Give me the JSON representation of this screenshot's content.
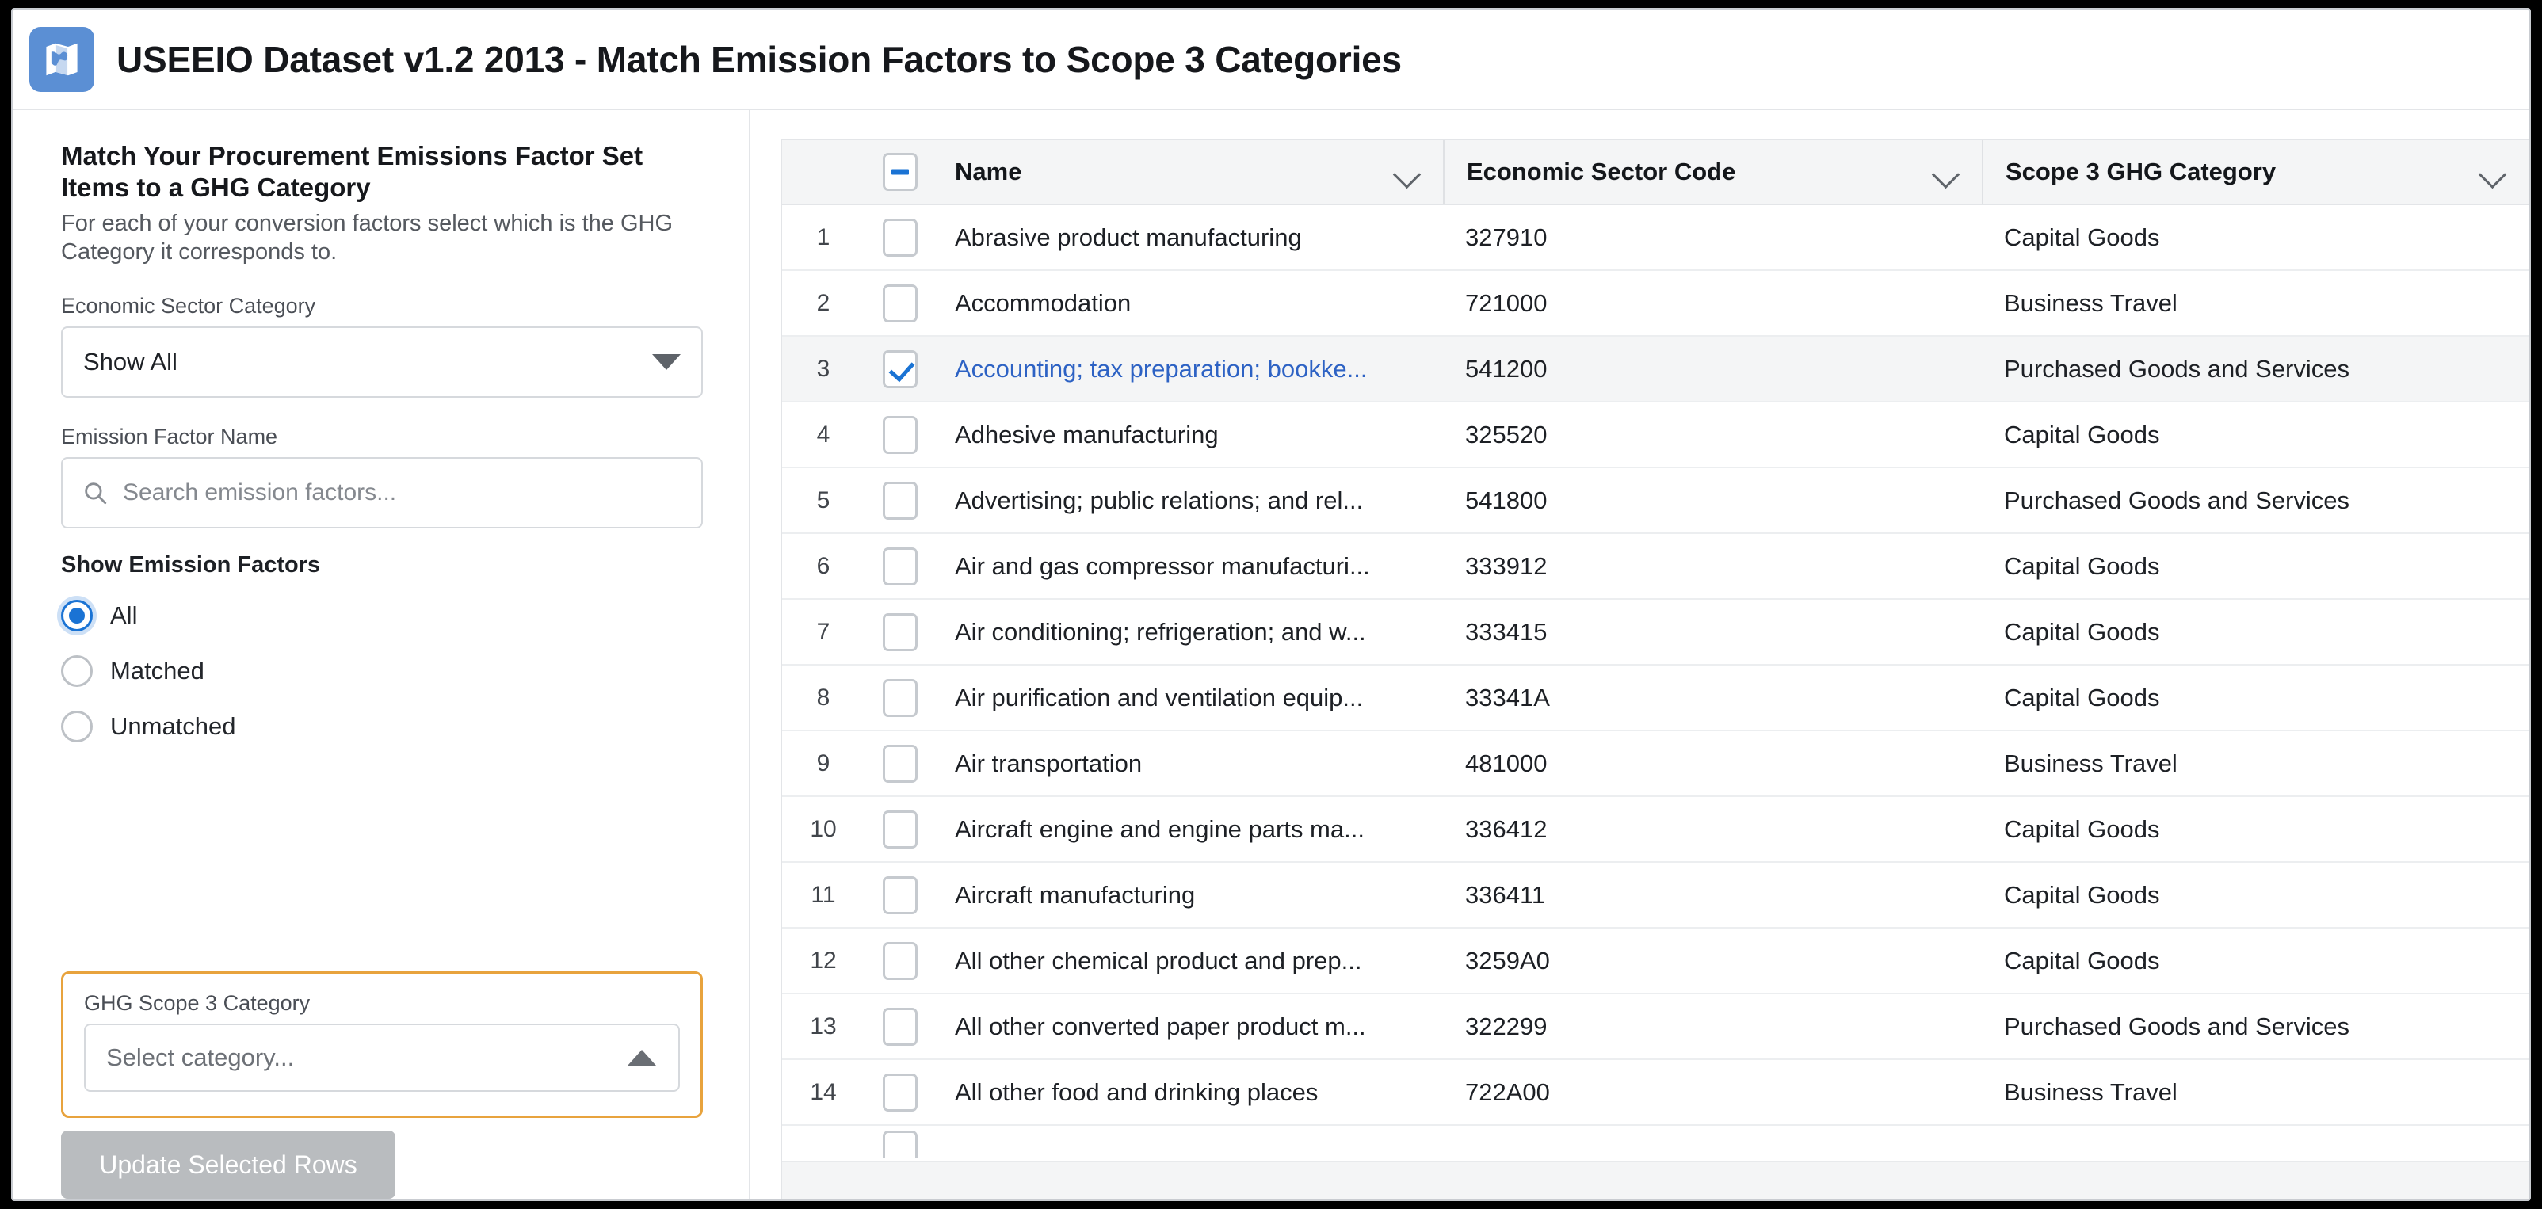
{
  "header": {
    "title": "USEEIO Dataset v1.2 2013 - Match Emission Factors to Scope 3 Categories",
    "logo_icon": "map-icon"
  },
  "side_panel": {
    "heading": "Match Your Procurement Emissions Factor Set Items to a GHG Category",
    "subheading": "For each of your conversion factors select which is the GHG Category it corresponds to.",
    "sector_category": {
      "label": "Economic Sector Category",
      "value": "Show All",
      "caret_icon": "caret-down-icon"
    },
    "emission_factor_name": {
      "label": "Emission Factor Name",
      "placeholder": "Search emission factors...",
      "value": "",
      "search_icon": "search-icon"
    },
    "show_emission_factors": {
      "label": "Show Emission Factors",
      "options": [
        {
          "label": "All",
          "selected": true
        },
        {
          "label": "Matched",
          "selected": false
        },
        {
          "label": "Unmatched",
          "selected": false
        }
      ]
    },
    "ghg_scope3": {
      "label": "GHG Scope 3 Category",
      "placeholder": "Select category...",
      "value": "",
      "caret_icon": "caret-up-icon",
      "highlight_color": "#e8a33d"
    },
    "update_button": {
      "label": "Update Selected Rows",
      "disabled": true
    }
  },
  "table": {
    "select_all_state": "indeterminate",
    "columns": [
      {
        "key": "name",
        "label": "Name",
        "sort_icon": "chevron-down-icon"
      },
      {
        "key": "code",
        "label": "Economic Sector Code",
        "sort_icon": "chevron-down-icon"
      },
      {
        "key": "category",
        "label": "Scope 3 GHG Category",
        "sort_icon": "chevron-down-icon"
      }
    ],
    "rows": [
      {
        "index": "1",
        "checked": false,
        "selected": false,
        "name": "Abrasive product manufacturing",
        "code": "327910",
        "category": "Capital Goods"
      },
      {
        "index": "2",
        "checked": false,
        "selected": false,
        "name": "Accommodation",
        "code": "721000",
        "category": "Business Travel"
      },
      {
        "index": "3",
        "checked": true,
        "selected": true,
        "name": "Accounting; tax preparation; bookke...",
        "code": "541200",
        "category": "Purchased Goods and Services"
      },
      {
        "index": "4",
        "checked": false,
        "selected": false,
        "name": "Adhesive manufacturing",
        "code": "325520",
        "category": "Capital Goods"
      },
      {
        "index": "5",
        "checked": false,
        "selected": false,
        "name": "Advertising; public relations; and rel...",
        "code": "541800",
        "category": "Purchased Goods and Services"
      },
      {
        "index": "6",
        "checked": false,
        "selected": false,
        "name": "Air and gas compressor manufacturi...",
        "code": "333912",
        "category": "Capital Goods"
      },
      {
        "index": "7",
        "checked": false,
        "selected": false,
        "name": "Air conditioning; refrigeration; and w...",
        "code": "333415",
        "category": "Capital Goods"
      },
      {
        "index": "8",
        "checked": false,
        "selected": false,
        "name": "Air purification and ventilation equip...",
        "code": "33341A",
        "category": "Capital Goods"
      },
      {
        "index": "9",
        "checked": false,
        "selected": false,
        "name": "Air transportation",
        "code": "481000",
        "category": "Business Travel"
      },
      {
        "index": "10",
        "checked": false,
        "selected": false,
        "name": "Aircraft engine and engine parts ma...",
        "code": "336412",
        "category": "Capital Goods"
      },
      {
        "index": "11",
        "checked": false,
        "selected": false,
        "name": "Aircraft manufacturing",
        "code": "336411",
        "category": "Capital Goods"
      },
      {
        "index": "12",
        "checked": false,
        "selected": false,
        "name": "All other chemical product and prep...",
        "code": "3259A0",
        "category": "Capital Goods"
      },
      {
        "index": "13",
        "checked": false,
        "selected": false,
        "name": "All other converted paper product m...",
        "code": "322299",
        "category": "Purchased Goods and Services"
      },
      {
        "index": "14",
        "checked": false,
        "selected": false,
        "name": "All other food and drinking places",
        "code": "722A00",
        "category": "Business Travel"
      }
    ]
  },
  "colors": {
    "accent_blue": "#1a73d4",
    "logo_blue": "#5b8fd4",
    "highlight_orange": "#e8a33d",
    "selected_row": "#f4f5f6",
    "link_blue": "#2d62c4"
  }
}
